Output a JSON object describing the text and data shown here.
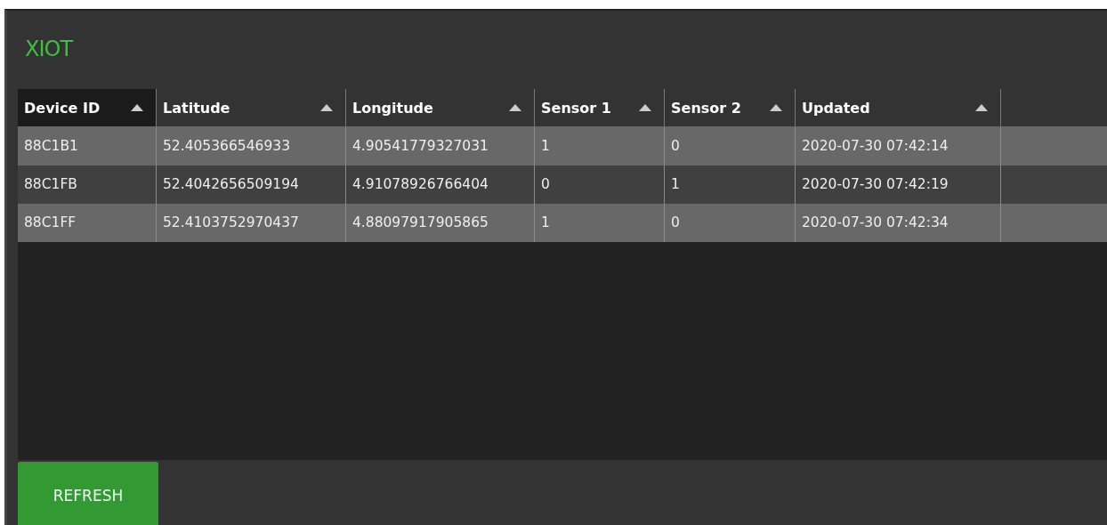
{
  "app": {
    "title": "XIOT"
  },
  "table": {
    "columns": [
      {
        "label": "Device ID",
        "selected": true
      },
      {
        "label": "Latitude",
        "selected": false
      },
      {
        "label": "Longitude",
        "selected": false
      },
      {
        "label": "Sensor 1",
        "selected": false
      },
      {
        "label": "Sensor 2",
        "selected": false
      },
      {
        "label": "Updated",
        "selected": false
      }
    ],
    "rows": [
      [
        "88C1B1",
        "52.405366546933",
        "4.90541779327031",
        "1",
        "0",
        "2020-07-30 07:42:14"
      ],
      [
        "88C1FB",
        "52.4042656509194",
        "4.91078926766404",
        "0",
        "1",
        "2020-07-30 07:42:19"
      ],
      [
        "88C1FF",
        "52.4103752970437",
        "4.88097917905865",
        "1",
        "0",
        "2020-07-30 07:42:34"
      ]
    ]
  },
  "buttons": [
    {
      "label": "REFRESH"
    }
  ]
}
